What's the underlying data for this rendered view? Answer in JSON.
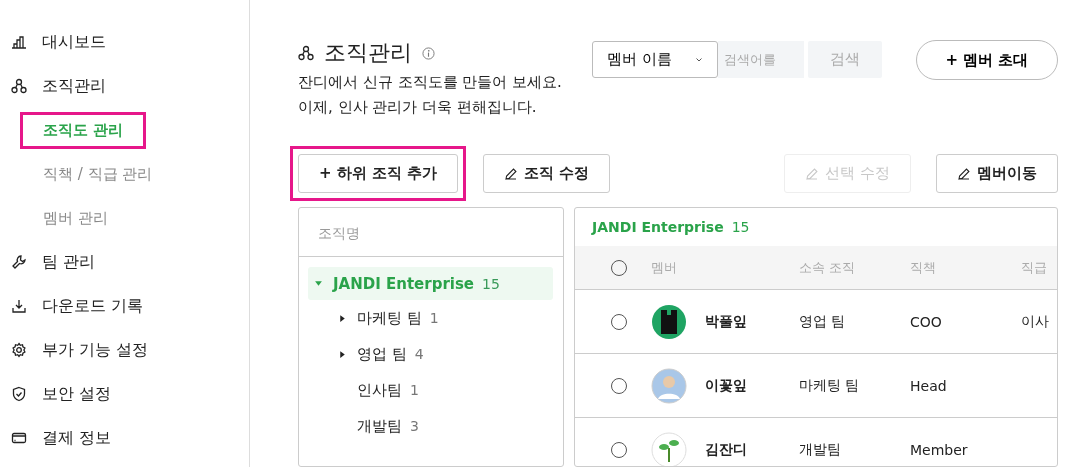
{
  "sidebar": {
    "items": [
      {
        "label": "대시보드"
      },
      {
        "label": "조직관리",
        "children": [
          {
            "label": "조직도 관리",
            "selected": true,
            "highlighted": true
          },
          {
            "label": "직책 / 직급 관리",
            "selected": false,
            "highlighted": false
          },
          {
            "label": "멤버 관리",
            "selected": false,
            "highlighted": false
          }
        ]
      },
      {
        "label": "팀 관리"
      },
      {
        "label": "다운로드 기록"
      },
      {
        "label": "부가 기능 설정"
      },
      {
        "label": "보안 설정"
      },
      {
        "label": "결제 정보"
      }
    ]
  },
  "header": {
    "title": "조직관리",
    "description": [
      "잔디에서 신규 조직도를 만들어 보세요.",
      "이제, 인사 관리가 더욱 편해집니다."
    ],
    "search_type": "멤버 이름",
    "search": {
      "placeholder": "검색어를"
    },
    "search_button": "검색",
    "invite_button": "+ 멤버 초대"
  },
  "toolbar": [
    {
      "label": "+ 하위 조직 추가",
      "kind": "plain",
      "disabled": false,
      "highlighted": true
    },
    {
      "label": "조직 수정",
      "kind": "edit",
      "disabled": false,
      "highlighted": false
    },
    {
      "label": "선택 수정",
      "kind": "edit",
      "disabled": true,
      "highlighted": false
    },
    {
      "label": "멤버이동",
      "kind": "edit",
      "disabled": false,
      "highlighted": false
    }
  ],
  "tree": {
    "heading": "조직명",
    "items": [
      {
        "label": "JANDI Enterprise",
        "count": "15",
        "kind": "branch",
        "expanded": true,
        "selected": true,
        "children": [
          {
            "label": "마케팅 팀",
            "count": "1",
            "kind": "branch",
            "expanded": false,
            "selected": false
          },
          {
            "label": "영업 팀",
            "count": "4",
            "kind": "branch",
            "expanded": false,
            "selected": false
          },
          {
            "label": "인사팀",
            "count": "1",
            "kind": "leaf",
            "selected": false
          },
          {
            "label": "개발팀",
            "count": "3",
            "kind": "leaf",
            "selected": false
          }
        ]
      }
    ]
  },
  "members": {
    "title": "JANDI Enterprise",
    "count": "15",
    "all_checked": false,
    "columns": [
      "멤버",
      "소속 조직",
      "직책",
      "직급"
    ],
    "rows": [
      {
        "name": "박풀잎",
        "org": "영업 팀",
        "position": "COO",
        "rank": "이사",
        "selected": false
      },
      {
        "name": "이꽃잎",
        "org": "마케팅 팀",
        "position": "Head",
        "selected": false
      },
      {
        "name": "김잔디",
        "org": "개발팀",
        "position": "Member",
        "selected": false
      }
    ]
  }
}
